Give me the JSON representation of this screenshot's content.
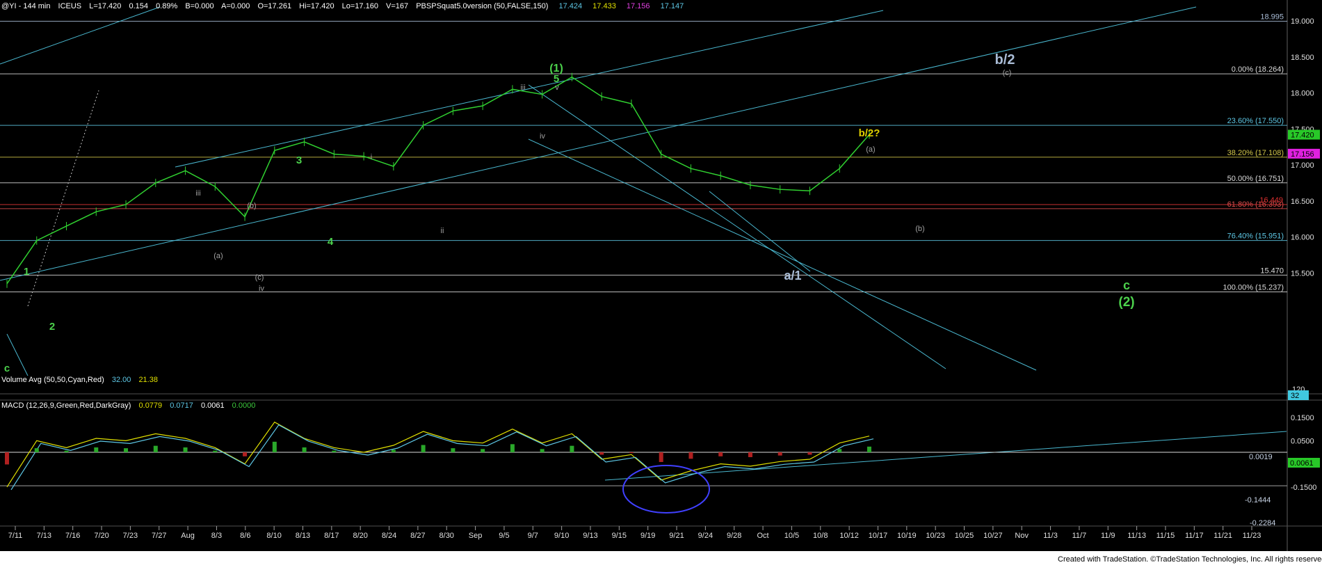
{
  "header": {
    "symbol": "@YI - 144 min",
    "exchange": "ICEUS",
    "last": "L=17.420",
    "change": "0.154",
    "change_pct": "0.89%",
    "bid": "B=0.000",
    "ask": "A=0.000",
    "open": "O=17.261",
    "high": "Hi=17.420",
    "low": "Lo=17.160",
    "volume": "V=167",
    "study": "PBSPSquat5.0version (50,FALSE,150)",
    "study_values": [
      "17.424",
      "17.433",
      "17.156",
      "17.147"
    ],
    "study_colors": [
      "#5ec8e6",
      "#e0e000",
      "#e040e0",
      "#5ec8e6"
    ]
  },
  "volume_panel": {
    "title": "Volume Avg (50,50,Cyan,Red)",
    "v1": "32.00",
    "v2": "21.38",
    "axis_120": "120",
    "badge": "32"
  },
  "macd_panel": {
    "title": "MACD (12,26,9,Green,Red,DarkGray)",
    "v1": "0.0779",
    "v2": "0.0717",
    "v3": "0.0061",
    "v4": "0.0000",
    "label_zero": "0.0019",
    "badge": "0.0061",
    "label_low": "-0.1444",
    "label_cut": "-0.2284"
  },
  "price_axis": [
    "19.000",
    "18.500",
    "18.000",
    "17.500",
    "17.000",
    "16.500",
    "16.000",
    "15.500"
  ],
  "macd_axis": [
    "0.1500",
    "0.0500",
    "-0.0500",
    "-0.1500"
  ],
  "price_badges": {
    "last": "17.420",
    "magenta": "17.156"
  },
  "x_axis": [
    "7/11",
    "7/13",
    "7/16",
    "7/20",
    "7/23",
    "7/27",
    "Aug",
    "8/3",
    "8/6",
    "8/10",
    "8/13",
    "8/17",
    "8/20",
    "8/24",
    "8/27",
    "8/30",
    "Sep",
    "9/5",
    "9/7",
    "9/10",
    "9/13",
    "9/15",
    "9/19",
    "9/21",
    "9/24",
    "9/28",
    "Oct",
    "10/5",
    "10/8",
    "10/12",
    "10/17",
    "10/19",
    "10/23",
    "10/25",
    "10/27",
    "Nov",
    "11/3",
    "11/7",
    "11/9",
    "11/13",
    "11/15",
    "11/17",
    "11/21",
    "11/23"
  ],
  "fib_levels": [
    {
      "label": "18.995",
      "price": 18.995,
      "color": "#a9bcd6"
    },
    {
      "label": "0.00% (18.264)",
      "price": 18.264,
      "color": "#dcdcdc"
    },
    {
      "label": "23.60% (17.550)",
      "price": 17.55,
      "color": "#5ec8e6"
    },
    {
      "label": "38.20% (17.108)",
      "price": 17.108,
      "color": "#d4c84a"
    },
    {
      "label": "50.00% (16.751)",
      "price": 16.751,
      "color": "#dcdcdc"
    },
    {
      "label": "61.80% (16.393)",
      "price": 16.393,
      "color": "#e05050"
    },
    {
      "label": "76.40% (15.951)",
      "price": 15.951,
      "color": "#5ec8e6"
    },
    {
      "label": "15.470",
      "price": 15.47,
      "color": "#dcdcdc"
    },
    {
      "label": "100.00% (15.237)",
      "price": 15.237,
      "color": "#dcdcdc"
    }
  ],
  "extra_red_label": "16.449",
  "wave_labels": [
    {
      "t": "(1)",
      "c": "#4cd24c",
      "s": 16,
      "b": true
    },
    {
      "t": "5",
      "c": "#4cd24c",
      "s": 15,
      "b": true
    },
    {
      "t": "3",
      "c": "#4cd24c",
      "s": 15,
      "b": true
    },
    {
      "t": "4",
      "c": "#4cd24c",
      "s": 15,
      "b": true
    },
    {
      "t": "1",
      "c": "#4cd24c",
      "s": 15,
      "b": true
    },
    {
      "t": "2",
      "c": "#4cd24c",
      "s": 15,
      "b": true
    },
    {
      "t": "c",
      "c": "#4cd24c",
      "s": 15,
      "b": true
    },
    {
      "t": "c",
      "c": "#4cd24c",
      "s": 18,
      "b": true
    },
    {
      "t": "(2)",
      "c": "#4cd24c",
      "s": 19,
      "b": true
    },
    {
      "t": "b/2",
      "c": "#a9bcd6",
      "s": 20,
      "b": true
    },
    {
      "t": "b/2?",
      "c": "#e0d000",
      "s": 15,
      "b": true
    },
    {
      "t": "a/1",
      "c": "#a9bcd6",
      "s": 18,
      "b": true
    },
    {
      "t": "(c)",
      "c": "#a0a0a0",
      "s": 11,
      "b": false
    },
    {
      "t": "(a)",
      "c": "#a0a0a0",
      "s": 11,
      "b": false
    },
    {
      "t": "(b)",
      "c": "#a0a0a0",
      "s": 11,
      "b": false
    },
    {
      "t": "iii",
      "c": "#a0a0a0",
      "s": 11,
      "b": false
    },
    {
      "t": "v",
      "c": "#a0a0a0",
      "s": 11,
      "b": false
    },
    {
      "t": "iv",
      "c": "#a0a0a0",
      "s": 11,
      "b": false
    },
    {
      "t": "iii",
      "c": "#a0a0a0",
      "s": 11,
      "b": false
    },
    {
      "t": "(b)",
      "c": "#a0a0a0",
      "s": 11,
      "b": false
    },
    {
      "t": "(a)",
      "c": "#a0a0a0",
      "s": 11,
      "b": false
    },
    {
      "t": "(c)",
      "c": "#a0a0a0",
      "s": 11,
      "b": false
    },
    {
      "t": "iv",
      "c": "#a0a0a0",
      "s": 11,
      "b": false
    },
    {
      "t": "i",
      "c": "#a0a0a0",
      "s": 11,
      "b": false
    },
    {
      "t": "ii",
      "c": "#a0a0a0",
      "s": 11,
      "b": false
    }
  ],
  "footer": "Created with TradeStation. ©TradeStation Technologies, Inc. All rights reserved.",
  "chart_data": {
    "type": "line",
    "title": "@YI - 144 min",
    "x": [
      "7/11",
      "7/13",
      "7/16",
      "7/20",
      "7/23",
      "7/27",
      "Aug",
      "8/3",
      "8/6",
      "8/10",
      "8/13",
      "8/17",
      "8/20",
      "8/24",
      "8/27",
      "8/30",
      "Sep",
      "9/5",
      "9/7",
      "9/10",
      "9/13",
      "9/15",
      "9/19",
      "9/21",
      "9/24",
      "9/28",
      "Oct",
      "10/5",
      "10/8",
      "10/12"
    ],
    "series": [
      {
        "values": [
          15.35,
          15.95,
          16.15,
          16.35,
          16.45,
          16.75,
          16.92,
          16.7,
          16.28,
          17.2,
          17.32,
          17.15,
          17.12,
          16.98,
          17.55,
          17.75,
          17.82,
          18.05,
          17.98,
          18.22,
          17.95,
          17.85,
          17.15,
          16.95,
          16.85,
          16.72,
          16.66,
          16.64,
          16.95,
          17.42
        ]
      }
    ],
    "ylim": [
      15.0,
      19.2
    ],
    "macd": {
      "line": [
        -0.15,
        0.05,
        0.02,
        0.06,
        0.05,
        0.08,
        0.06,
        0.02,
        -0.05,
        0.13,
        0.06,
        0.02,
        0.0,
        0.03,
        0.09,
        0.05,
        0.04,
        0.1,
        0.04,
        0.08,
        -0.03,
        -0.01,
        -0.12,
        -0.08,
        -0.05,
        -0.06,
        -0.04,
        -0.03,
        0.04,
        0.07
      ],
      "ylim": [
        -0.24,
        0.22
      ]
    }
  }
}
